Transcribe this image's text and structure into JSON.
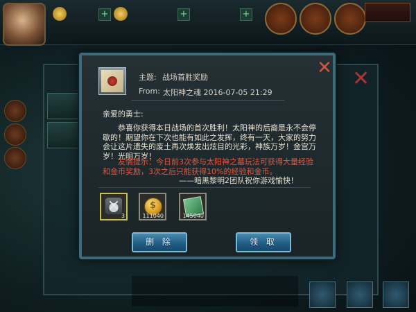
{
  "mail": {
    "subject_label": "主题:",
    "subject": "战场首胜奖励",
    "from_label": "From:",
    "from": "太阳神之魂 2016-07-05 21:29",
    "greeting": "亲爱的勇士:",
    "body": "恭喜你获得本日战场的首次胜利！太阳神的后裔是永不会停歇的！期望你在下次也能有如此之发挥，终有一天，大家的努力会让这片遗失的废土再次焕发出炫目的光彩，神族万岁！金宫万岁！光明万岁！",
    "tip": "友情提示：今日前3次参与太阳神之墓玩法可获得大量经验和金币奖励，3次之后只能获得10%的经验和金币。",
    "signature": "——暗黑黎明2团队祝你游戏愉快！",
    "attachments": [
      {
        "icon": "medal-icon",
        "quantity": "3",
        "selected": true
      },
      {
        "icon": "gold-coin-icon",
        "quantity": "111040",
        "selected": false
      },
      {
        "icon": "experience-book-icon",
        "quantity": "145040",
        "selected": false
      }
    ],
    "delete_label": "删 除",
    "claim_label": "领 取"
  },
  "colors": {
    "frame": "#3e6a7c",
    "tip_text": "#e8543e",
    "close": "#d2543e",
    "button": "#1e5a82"
  }
}
